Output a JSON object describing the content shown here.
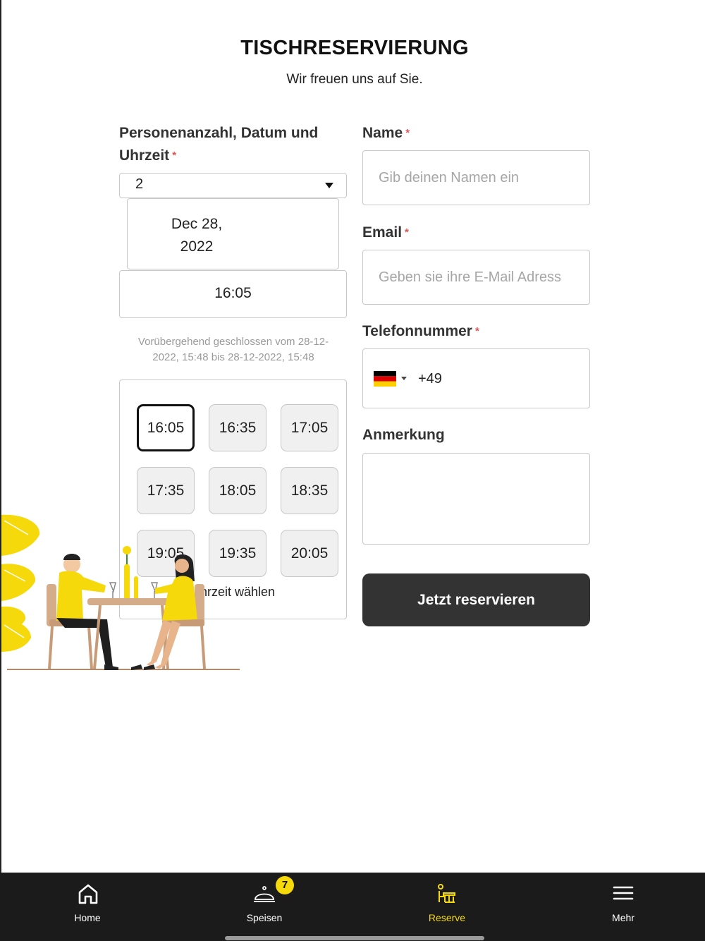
{
  "header": {
    "title": "TISCHRESERVIERUNG",
    "subtitle": "Wir freuen uns auf Sie."
  },
  "booking": {
    "label_line1": "Personenanzahl, Datum und",
    "label_line2": "Uhrzeit",
    "required_mark": "*",
    "guests_value": "2",
    "date_line1": "Dec 28,",
    "date_line2": "2022",
    "time_value": "16:05",
    "notice_line1": "Vorübergehend geschlossen vom 28-12-",
    "notice_line2": "2022, 15:48 bis 28-12-2022, 15:48",
    "slots": [
      "16:05",
      "16:35",
      "17:05",
      "17:35",
      "18:05",
      "18:35",
      "19:05",
      "19:35",
      "20:05"
    ],
    "selected_slot": "16:05",
    "slot_hint": "Uhrzeit wählen"
  },
  "contact": {
    "name_label": "Name",
    "name_placeholder": "Gib deinen Namen ein",
    "email_label": "Email",
    "email_placeholder": "Geben sie ihre E-Mail Adress",
    "phone_label": "Telefonnummer",
    "phone_prefix": "+49",
    "remark_label": "Anmerkung",
    "required_mark": "*",
    "submit_label": "Jetzt reservieren"
  },
  "tabbar": {
    "items": [
      {
        "label": "Home",
        "icon": "home-icon"
      },
      {
        "label": "Speisen",
        "icon": "cloche-icon",
        "badge": "7"
      },
      {
        "label": "Reserve",
        "icon": "dining-table-icon",
        "active": true
      },
      {
        "label": "Mehr",
        "icon": "menu-icon"
      }
    ]
  },
  "colors": {
    "accent": "#f5d90a",
    "button_bg": "#333333",
    "tabbar_bg": "#1b1b1b",
    "required": "#e05555"
  }
}
